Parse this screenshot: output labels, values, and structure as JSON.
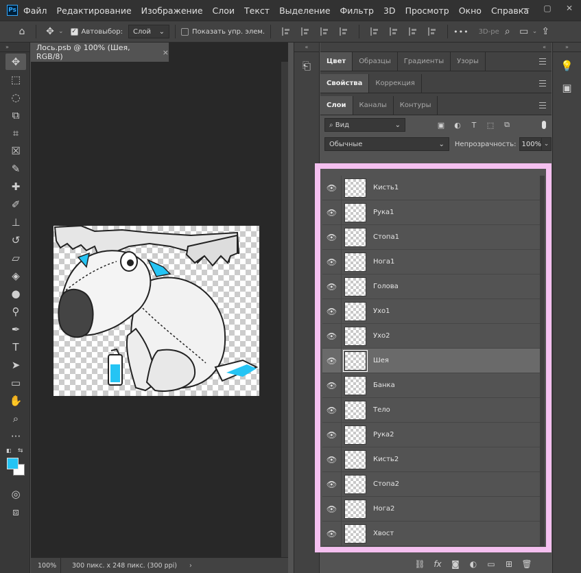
{
  "app": {
    "logo_text": "Ps",
    "menu": [
      "Файл",
      "Редактирование",
      "Изображение",
      "Слои",
      "Текст",
      "Выделение",
      "Фильтр",
      "3D",
      "Просмотр",
      "Окно",
      "Справка"
    ],
    "window_controls": [
      "—",
      "▢",
      "✕"
    ]
  },
  "options": {
    "autoselect_label": "Автовыбор:",
    "autoselect_checked": true,
    "autoselect_value": "Слой",
    "show_transform_label": "Показать упр. элем.",
    "mode_3d": "3D-ре",
    "more": "•••"
  },
  "document": {
    "tab_title": "Лось.psb @ 100% (Шея, RGB/8)",
    "close_glyph": "×",
    "zoom": "100%",
    "info": "300 пикс. x 248 пикс. (300 ppi)",
    "arrow": "›"
  },
  "panels": {
    "group1_tabs": [
      "Цвет",
      "Образцы",
      "Градиенты",
      "Узоры"
    ],
    "group2_tabs": [
      "Свойства",
      "Коррекция"
    ],
    "group3_tabs": [
      "Слои",
      "Каналы",
      "Контуры"
    ],
    "filter_kind": "Вид",
    "blend_mode": "Обычные",
    "opacity_label": "Непрозрачность:",
    "opacity_value": "100%"
  },
  "layers": [
    {
      "name": "Кисть1",
      "selected": false
    },
    {
      "name": "Рука1",
      "selected": false
    },
    {
      "name": "Стопа1",
      "selected": false
    },
    {
      "name": "Нога1",
      "selected": false
    },
    {
      "name": "Голова",
      "selected": false
    },
    {
      "name": "Ухо1",
      "selected": false
    },
    {
      "name": "Ухо2",
      "selected": false
    },
    {
      "name": "Шея",
      "selected": true
    },
    {
      "name": "Банка",
      "selected": false
    },
    {
      "name": "Тело",
      "selected": false
    },
    {
      "name": "Рука2",
      "selected": false
    },
    {
      "name": "Кисть2",
      "selected": false
    },
    {
      "name": "Стопа2",
      "selected": false
    },
    {
      "name": "Нога2",
      "selected": false
    },
    {
      "name": "Хвост",
      "selected": false
    }
  ],
  "colors": {
    "foreground": "#25c4f4",
    "background": "#ffffff",
    "highlight": "#f5c0f0"
  }
}
